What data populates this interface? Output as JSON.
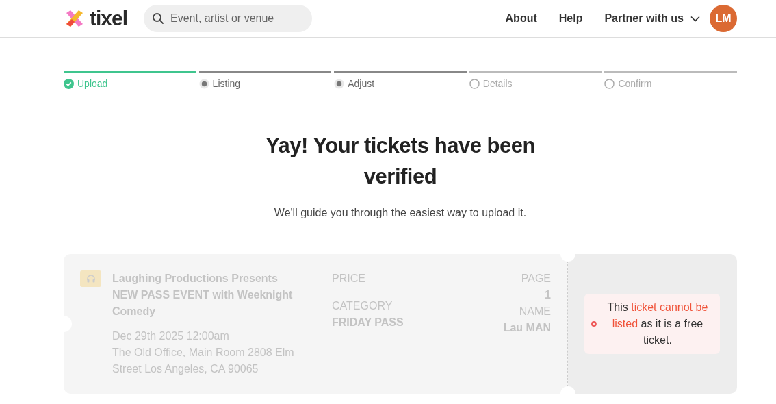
{
  "header": {
    "logo": "tixel",
    "search": {
      "placeholder": "Event, artist or venue"
    },
    "nav": [
      "About",
      "Help"
    ],
    "partner_menu": {
      "label": "Partner with us"
    },
    "avatar": "LM"
  },
  "steps": [
    {
      "label": "Upload",
      "kind": "done"
    },
    {
      "label": "Listing",
      "kind": "visited"
    },
    {
      "label": "Adjust",
      "kind": "visited"
    },
    {
      "label": "Details",
      "kind": "pending"
    },
    {
      "label": "Confirm",
      "kind": "pending"
    }
  ],
  "title": "Yay! Your tickets have been verified",
  "subtitle": "We'll guide you through the easiest way to upload it.",
  "ticket": {
    "event_title": "Laughing Productions Presents NEW PASS EVENT with Weeknight Comedy",
    "date": "Dec 29th 2025 12:00am",
    "venue": "The Old Office, Main Room 2808 Elm Street Los Angeles, CA 90065",
    "fields_left": [
      {
        "label": "PRICE"
      },
      {
        "label": "CATEGORY",
        "value": "FRIDAY PASS"
      }
    ],
    "fields_right": [
      {
        "label": "PAGE",
        "value": "1"
      },
      {
        "label": "NAME",
        "value": "Lau MAN"
      }
    ],
    "error": {
      "before": "This ",
      "highlight": "ticket cannot be listed",
      "after": " as it is a free ticket."
    }
  }
}
